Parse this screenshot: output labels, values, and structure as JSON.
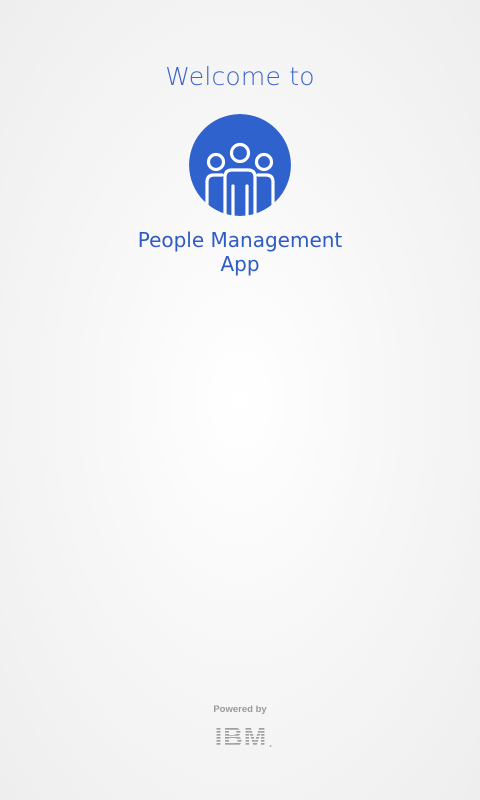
{
  "welcome": {
    "text": "Welcome to"
  },
  "app": {
    "name_line1": "People Management",
    "name_line2": "App",
    "logo_icon": "people-group-icon",
    "accent_color": "#2f62cc"
  },
  "footer": {
    "powered_by": "Powered by",
    "brand": "IBM",
    "brand_logo_icon": "ibm-logo-icon"
  }
}
